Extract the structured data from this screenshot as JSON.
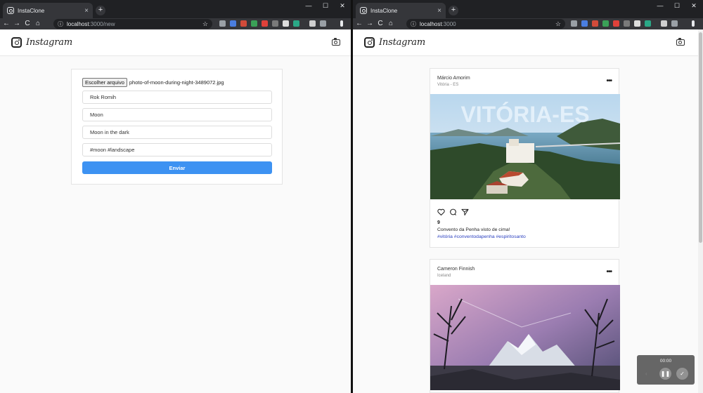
{
  "left_window": {
    "tab_title": "InstaClone",
    "url_host": "localhost",
    "url_path": ":3000/new",
    "brand": "Instagram",
    "form": {
      "file_button": "Escolher arquivo",
      "file_name": "photo-of-moon-during-night-3489072.jpg",
      "author": "Rok Romih",
      "place": "Moon",
      "description": "Moon in the dark",
      "hashtags": "#moon #landscape",
      "submit_label": "Enviar"
    }
  },
  "right_window": {
    "tab_title": "InstaClone",
    "url_host": "localhost",
    "url_path": ":3000",
    "brand": "Instagram",
    "posts": [
      {
        "author": "Márcio Amorim",
        "place": "Vitória - ES",
        "image_caption_text": "VITÓRIA-ES",
        "likes": "9",
        "description": "Convento da Penha visto de cima!",
        "hashtags": "#vitória #conventodapenha #espiritosanto"
      },
      {
        "author": "Cameron Finnish",
        "place": "Iceland"
      }
    ]
  },
  "recorder": {
    "time": "00:00"
  },
  "colors": {
    "submit_blue": "#3d92f2",
    "hashtag_blue": "#2a3fbf",
    "chrome_dark": "#202124"
  }
}
